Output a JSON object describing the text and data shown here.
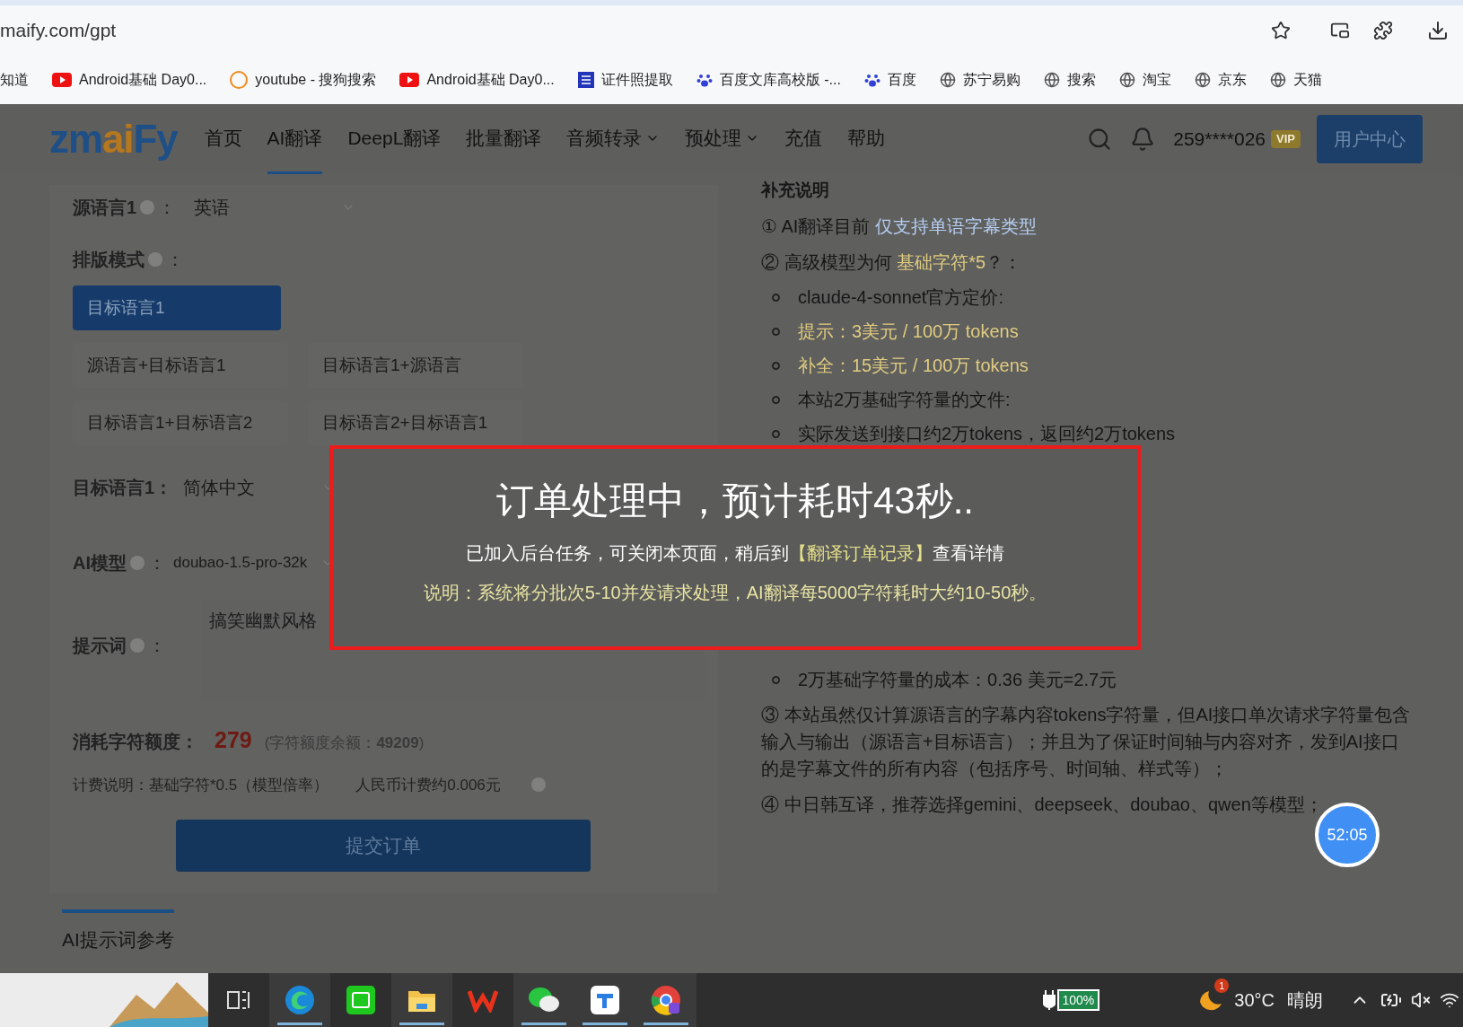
{
  "browser": {
    "url": "maify.com/gpt",
    "bookmarks": [
      {
        "label": "知道",
        "kind": "plain"
      },
      {
        "label": "Android基础 Day0...",
        "kind": "video"
      },
      {
        "label": "youtube - 搜狗搜索",
        "kind": "search"
      },
      {
        "label": "Android基础 Day0...",
        "kind": "video"
      },
      {
        "label": "证件照提取",
        "kind": "doc"
      },
      {
        "label": "百度文库高校版 -...",
        "kind": "paw"
      },
      {
        "label": "百度",
        "kind": "paw"
      },
      {
        "label": "苏宁易购",
        "kind": "globe"
      },
      {
        "label": "搜索",
        "kind": "globe"
      },
      {
        "label": "淘宝",
        "kind": "globe"
      },
      {
        "label": "京东",
        "kind": "globe"
      },
      {
        "label": "天猫",
        "kind": "globe"
      }
    ]
  },
  "nav": {
    "logo": [
      {
        "text": "zm",
        "color": "#1e4f86"
      },
      {
        "text": "ai",
        "color": "#b5781e"
      },
      {
        "text": "Fy",
        "color": "#1e4f86"
      }
    ],
    "items": [
      {
        "label": "首页",
        "selected": false,
        "dropdown": false
      },
      {
        "label": "AI翻译",
        "selected": true,
        "dropdown": false
      },
      {
        "label": "DeepL翻译",
        "selected": false,
        "dropdown": false
      },
      {
        "label": "批量翻译",
        "selected": false,
        "dropdown": false
      },
      {
        "label": "音频转录",
        "selected": false,
        "dropdown": true
      },
      {
        "label": "预处理",
        "selected": false,
        "dropdown": true
      },
      {
        "label": "充值",
        "selected": false,
        "dropdown": false
      },
      {
        "label": "帮助",
        "selected": false,
        "dropdown": false
      }
    ],
    "user": "259****026",
    "badge": "VIP",
    "account_button": "用户中心"
  },
  "form": {
    "source_language": {
      "label": "源语言1",
      "suffix": "：",
      "value": "英语"
    },
    "layout_mode": {
      "label": "排版模式",
      "suffix": "：",
      "options": [
        {
          "label": "目标语言1",
          "selected": true
        },
        {
          "label": "源语言+目标语言1",
          "selected": false
        },
        {
          "label": "目标语言1+源语言",
          "selected": false
        },
        {
          "label": "目标语言1+目标语言2",
          "selected": false
        },
        {
          "label": "目标语言2+目标语言1",
          "selected": false
        }
      ]
    },
    "target_language": {
      "label": "目标语言1：",
      "value": "简体中文"
    },
    "model": {
      "label": "AI模型",
      "suffix": "：",
      "value": "doubao-1.5-pro-32k"
    },
    "prompt": {
      "label": "提示词",
      "suffix": "：",
      "value": "搞笑幽默风格"
    },
    "cost": {
      "label": "消耗字符额度：",
      "value": "279",
      "balance": "(字符额度余额：**49209**)"
    },
    "billing": [
      "计费说明：基础字符*0.5（模型倍率）",
      "人民币计费约0.006元"
    ],
    "submit": "提交订单"
  },
  "bottom_tabs": [
    {
      "label": "AI提示词参考",
      "selected": true
    }
  ],
  "notes": {
    "title": "补充说明",
    "items": [
      {
        "kind": "para",
        "parts": [
          {
            "text": "① AI翻译目前 ",
            "kind": "plain"
          },
          {
            "text": "仅支持单语字幕类型",
            "kind": "link"
          }
        ]
      },
      {
        "kind": "para",
        "parts": [
          {
            "text": "② 高级模型为何 ",
            "kind": "plain"
          },
          {
            "text": "基础字符*5",
            "kind": "highlight"
          },
          {
            "text": "？：",
            "kind": "plain"
          }
        ]
      },
      {
        "kind": "bullet",
        "parts": [
          {
            "text": "claude-4-sonnet官方定价:",
            "kind": "plain"
          }
        ]
      },
      {
        "kind": "bullet",
        "parts": [
          {
            "text": "提示：3美元 / 100万 tokens",
            "kind": "highlight"
          }
        ]
      },
      {
        "kind": "bullet",
        "parts": [
          {
            "text": "补全：15美元 / 100万 tokens",
            "kind": "highlight"
          }
        ]
      },
      {
        "kind": "bullet",
        "parts": [
          {
            "text": "本站2万基础字符量的文件:",
            "kind": "plain"
          }
        ]
      },
      {
        "kind": "bullet",
        "parts": [
          {
            "text": "实际发送到接口约2万tokens，返回约2万tokens",
            "kind": "plain"
          }
        ]
      },
      {
        "kind": "gap"
      },
      {
        "kind": "bullet",
        "parts": [
          {
            "text": "2万基础字符量的成本：0.36 美元=2.7元",
            "kind": "plain"
          }
        ]
      },
      {
        "kind": "para",
        "parts": [
          {
            "text": "③ 本站虽然仅计算源语言的字幕内容tokens字符量，但AI接口单次请求字符量包含输入与输出（源语言+目标语言）；并且为了保证时间轴与内容对齐，发到AI接口的是字幕文件的所有内容（包括序号、时间轴、样式等）；",
            "kind": "plain"
          }
        ]
      },
      {
        "kind": "para",
        "parts": [
          {
            "text": "④ 中日韩互译，推荐选择gemini、deepseek、doubao、qwen等模型；",
            "kind": "plain"
          }
        ]
      }
    ]
  },
  "dialog": {
    "title": "订单处理中，预计耗时43秒..",
    "message": [
      {
        "text": "已加入后台任务，可关闭本页面，稍后到",
        "kind": "plain"
      },
      {
        "text": "【翻译订单记录】",
        "kind": "highlight"
      },
      {
        "text": "查看详情",
        "kind": "plain"
      }
    ],
    "note": "说明：系统将分批次5-10并发请求处理，AI翻译每5000字符耗时大约10-50秒。"
  },
  "timer": "52:05",
  "taskbar": {
    "apps": [
      {
        "kind": "taskview",
        "running": false
      },
      {
        "kind": "edge",
        "running": true
      },
      {
        "kind": "green",
        "running": false
      },
      {
        "kind": "folder",
        "running": true
      },
      {
        "kind": "wps",
        "running": false
      },
      {
        "kind": "chat",
        "running": true
      },
      {
        "kind": "blue",
        "running": true
      },
      {
        "kind": "chrome",
        "running": true
      }
    ],
    "battery": "100%",
    "weather_badge": "1",
    "temperature": "30°C",
    "weather": "晴朗"
  }
}
